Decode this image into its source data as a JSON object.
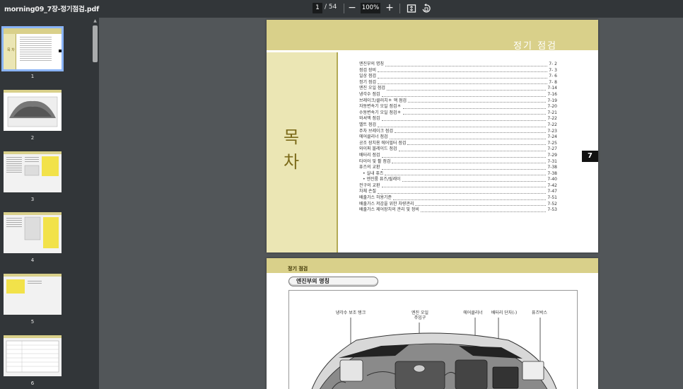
{
  "toolbar": {
    "title": "morning09_7장-정기점검.pdf",
    "current_page": "1",
    "total_pages": "/ 54",
    "zoom_out": "−",
    "zoom_level": "100%",
    "zoom_in": "+",
    "icons": [
      "fit-page-icon",
      "rotate-icon"
    ]
  },
  "sidebar": {
    "thumbnails": [
      {
        "label": "1",
        "selected": true
      },
      {
        "label": "2",
        "selected": false
      },
      {
        "label": "3",
        "selected": false
      },
      {
        "label": "4",
        "selected": false
      },
      {
        "label": "5",
        "selected": false
      },
      {
        "label": "6",
        "selected": false
      }
    ]
  },
  "page1": {
    "heading": "정기 점검",
    "mokcha": "목 차",
    "chapter_tab": "7",
    "toc": [
      {
        "title": "엔진부의 명칭",
        "page": "7- 2"
      },
      {
        "title": "점검 장비",
        "page": "7- 3"
      },
      {
        "title": "일상 점검",
        "page": "7- 6"
      },
      {
        "title": "정기 점검",
        "page": "7- 8"
      },
      {
        "title": "엔진 오일 점검",
        "page": "7-14"
      },
      {
        "title": "냉각수 점검",
        "page": "7-16"
      },
      {
        "title": "브레이크/클러치＊ 액 점검",
        "page": "7-19"
      },
      {
        "title": "자동변속기 오일 점검＊",
        "page": "7-20"
      },
      {
        "title": "수동변속기 오일 점검＊",
        "page": "7-21"
      },
      {
        "title": "와셔액 점검",
        "page": "7-22"
      },
      {
        "title": "벨트 점검",
        "page": "7-22"
      },
      {
        "title": "주차 브레이크 점검",
        "page": "7-23"
      },
      {
        "title": "에어클리너 점검",
        "page": "7-24"
      },
      {
        "title": "공조 장치용 에어필터 점검",
        "page": "7-25"
      },
      {
        "title": "와이퍼 블레이드 점검",
        "page": "7-27"
      },
      {
        "title": "배터리 점검",
        "page": "7-29"
      },
      {
        "title": "타이어 및 휠 점검",
        "page": "7-31"
      },
      {
        "title": "퓨즈의 교환",
        "page": "7-38"
      },
      {
        "title": "• 실내 퓨즈",
        "page": "7-38",
        "sub": true
      },
      {
        "title": "• 엔진룸 퓨즈/릴레이",
        "page": "7-40",
        "sub": true
      },
      {
        "title": "전구의 교환",
        "page": "7-42"
      },
      {
        "title": "차체 손질",
        "page": "7-47"
      },
      {
        "title": "배출가스 허용기준",
        "page": "7-51"
      },
      {
        "title": "배출가스 저감을 위한 차량관리",
        "page": "7-52"
      },
      {
        "title": "배출가스 제어장치의 관리 및 정비",
        "page": "7-53"
      }
    ]
  },
  "page2": {
    "band_title": "정기 점검",
    "section_title": "엔진부의 명칭",
    "figure_labels": {
      "coolant_tank": "냉각수 보조 탱크",
      "oil_filler": "엔진 오일\n주입구",
      "air_cleaner": "에어클리너",
      "battery": "배터리 단자(-)",
      "fuse_box": "퓨즈박스"
    }
  },
  "colors": {
    "toolbar_bg": "#323639",
    "viewer_bg": "#525659",
    "band": "#d9d08a",
    "left_panel": "#ebe6b4",
    "selected_outline": "#8ab4f8"
  }
}
